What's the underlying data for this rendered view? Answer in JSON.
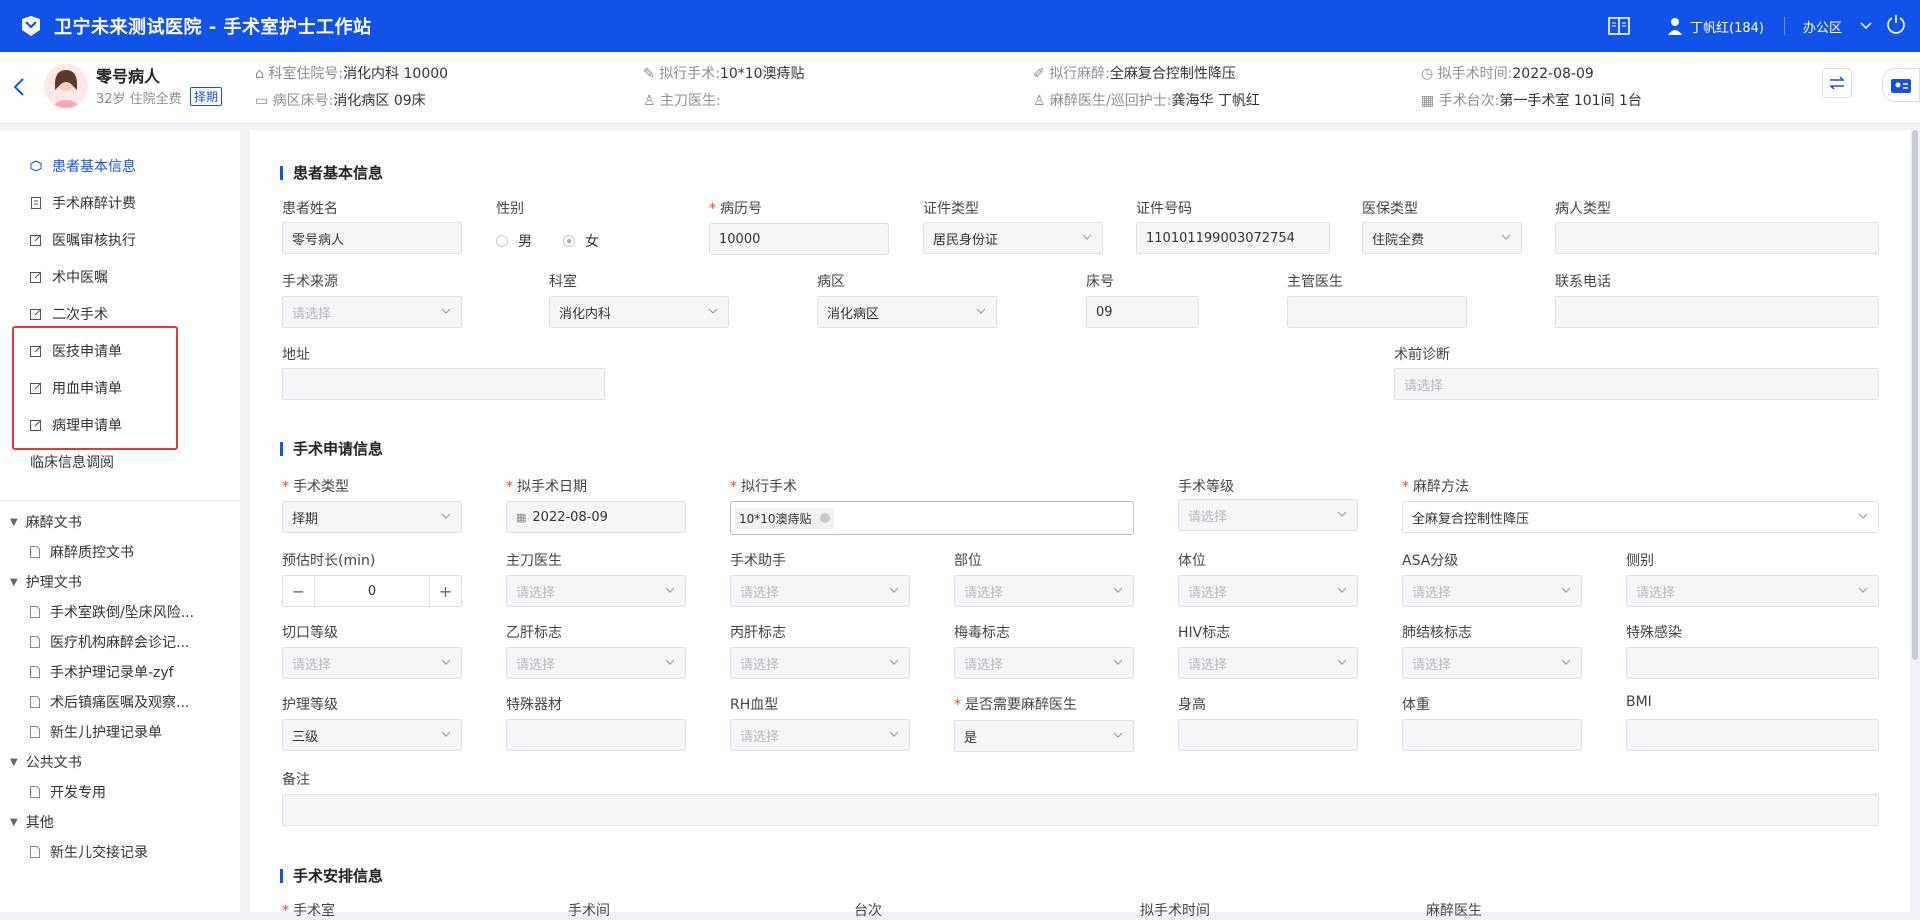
{
  "app": {
    "title": "卫宁未来测试医院 - 手术室护士工作站",
    "user": "丁帆红(184)",
    "location": "办公区"
  },
  "patient": {
    "name": "零号病人",
    "age_info": "32岁 住院全费",
    "tag": "择期",
    "fields": [
      {
        "label": "科室住院号:",
        "value": "消化内科 10000"
      },
      {
        "label": "病区床号:",
        "value": "消化病区 09床"
      },
      {
        "label": "拟行手术:",
        "value": "10*10澳痔贴"
      },
      {
        "label": "主刀医生:",
        "value": ""
      },
      {
        "label": "拟行麻醉:",
        "value": "全麻复合控制性降压"
      },
      {
        "label": "麻醉医生/巡回护士:",
        "value": "龚海华 丁帆红"
      },
      {
        "label": "拟手术时间:",
        "value": "2022-08-09"
      },
      {
        "label": "手术台次:",
        "value": "第一手术室 101间 1台"
      }
    ]
  },
  "sidebar": {
    "items": [
      {
        "label": "患者基本信息",
        "active": true
      },
      {
        "label": "手术麻醉计费"
      },
      {
        "label": "医嘱审核执行"
      },
      {
        "label": "术中医嘱"
      },
      {
        "label": "二次手术"
      },
      {
        "label": "医技申请单"
      },
      {
        "label": "用血申请单"
      },
      {
        "label": "病理申请单"
      },
      {
        "label": "临床信息调阅"
      }
    ],
    "groups": [
      {
        "label": "麻醉文书",
        "children": [
          "麻醉质控文书"
        ]
      },
      {
        "label": "护理文书",
        "children": [
          "手术室跌倒/坠床风险...",
          "医疗机构麻醉会诊记...",
          "手术护理记录单-zyf",
          "术后镇痛医嘱及观察...",
          "新生儿护理记录单"
        ]
      },
      {
        "label": "公共文书",
        "children": [
          "开发专用"
        ]
      },
      {
        "label": "其他",
        "children": [
          "新生儿交接记录"
        ]
      }
    ]
  },
  "basic": {
    "title": "患者基本信息",
    "name_label": "患者姓名",
    "name": "零号病人",
    "gender_label": "性别",
    "male": "男",
    "female": "女",
    "record_label": "病历号",
    "record": "10000",
    "idtype_label": "证件类型",
    "idtype": "居民身份证",
    "idno_label": "证件号码",
    "idno": "110101199003072754",
    "ins_label": "医保类型",
    "ins": "住院全费",
    "ptype_label": "病人类型",
    "source_label": "手术来源",
    "source_ph": "请选择",
    "dept_label": "科室",
    "dept": "消化内科",
    "ward_label": "病区",
    "ward": "消化病区",
    "bed_label": "床号",
    "bed": "09",
    "doctor_label": "主管医生",
    "phone_label": "联系电话",
    "addr_label": "地址",
    "diag_label": "术前诊断",
    "diag_ph": "请选择"
  },
  "apply": {
    "title": "手术申请信息",
    "type_label": "手术类型",
    "type": "择期",
    "date_label": "拟手术日期",
    "date": "2022-08-09",
    "op_label": "拟行手术",
    "op_tag": "10*10澳痔贴",
    "level_label": "手术等级",
    "level_ph": "请选择",
    "anes_label": "麻醉方法",
    "anes": "全麻复合控制性降压",
    "dur_label": "预估时长(min)",
    "dur": "0",
    "surgeon_label": "主刀医生",
    "assist_label": "手术助手",
    "part_label": "部位",
    "pos_label": "体位",
    "asa_label": "ASA分级",
    "side_label": "侧别",
    "cut_label": "切口等级",
    "hbv_label": "乙肝标志",
    "hcv_label": "丙肝标志",
    "syph_label": "梅毒标志",
    "hiv_label": "HIV标志",
    "tb_label": "肺结核标志",
    "inf_label": "特殊感染",
    "nurse_label": "护理等级",
    "nurse": "三级",
    "equip_label": "特殊器材",
    "rh_label": "RH血型",
    "need_label": "是否需要麻醉医生",
    "need": "是",
    "height_label": "身高",
    "weight_label": "体重",
    "bmi_label": "BMI",
    "note_label": "备注",
    "ph": "请选择"
  },
  "arrange": {
    "title": "手术安排信息",
    "room_label": "手术室",
    "room2_label": "手术间",
    "seq_label": "台次",
    "time_label": "拟手术时间",
    "anes_doc_label": "麻醉医生"
  }
}
